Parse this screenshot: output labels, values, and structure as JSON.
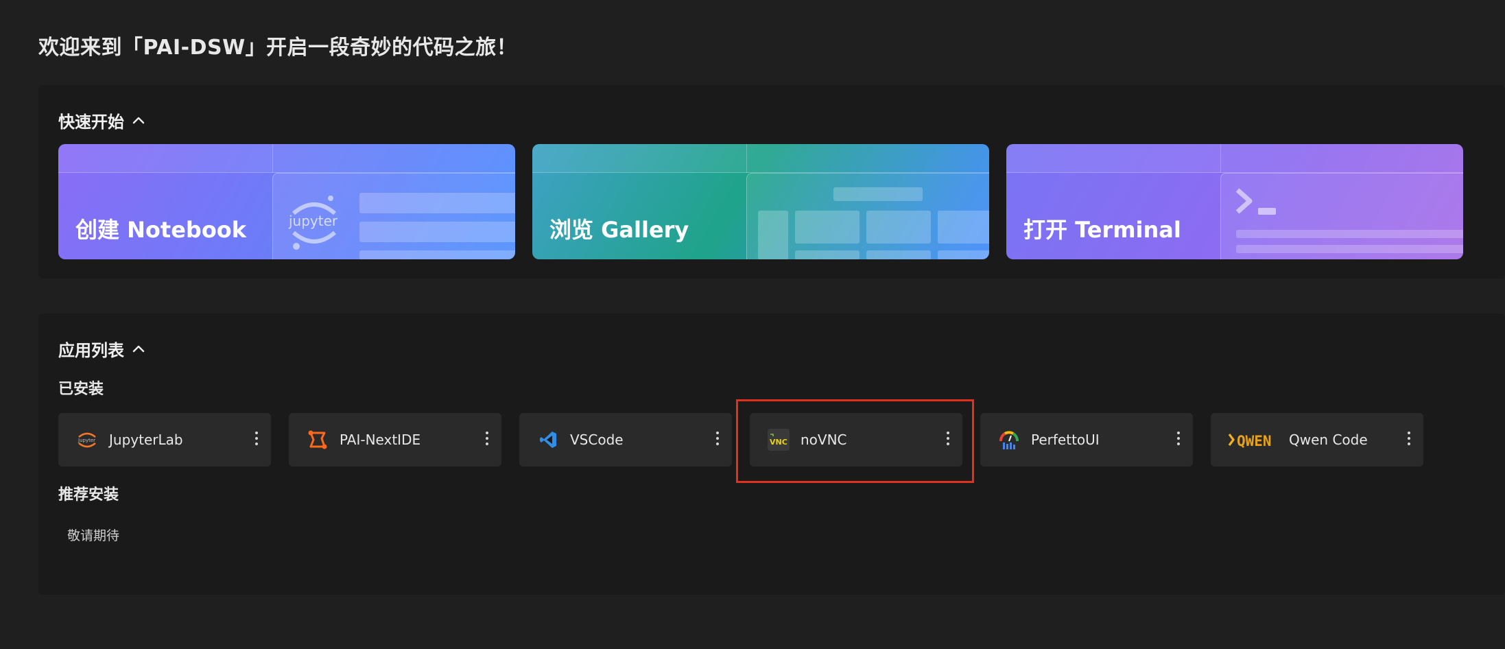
{
  "page": {
    "title": "欢迎来到「PAI-DSW」开启一段奇妙的代码之旅！"
  },
  "quick_start": {
    "heading": "快速开始",
    "cards": [
      {
        "label": "创建 Notebook",
        "icon": "jupyter-logo"
      },
      {
        "label": "浏览 Gallery",
        "icon": "gallery-grid"
      },
      {
        "label": "打开 Terminal",
        "icon": "terminal-prompt"
      }
    ]
  },
  "apps": {
    "heading": "应用列表",
    "installed_heading": "已安装",
    "installed": [
      {
        "name": "JupyterLab",
        "icon": "jupyter-icon"
      },
      {
        "name": "PAI-NextIDE",
        "icon": "nextide-icon"
      },
      {
        "name": "VSCode",
        "icon": "vscode-icon"
      },
      {
        "name": "noVNC",
        "icon": "novnc-icon"
      },
      {
        "name": "PerfettoUI",
        "icon": "perfetto-icon"
      },
      {
        "name": "Qwen Code",
        "icon": "qwen-icon"
      }
    ],
    "recommended_heading": "推荐安装",
    "recommended_empty": "敬请期待"
  },
  "icon_labels": {
    "jupyter_small": "Jupyter",
    "jupyter_card": "jupyter",
    "novnc": "VNC",
    "qwen": "QWEN"
  },
  "colors": {
    "background": "#1f1f1f",
    "panel": "#1a1a1a",
    "app_tile": "#2a2a2a",
    "highlight": "#e0301e"
  }
}
